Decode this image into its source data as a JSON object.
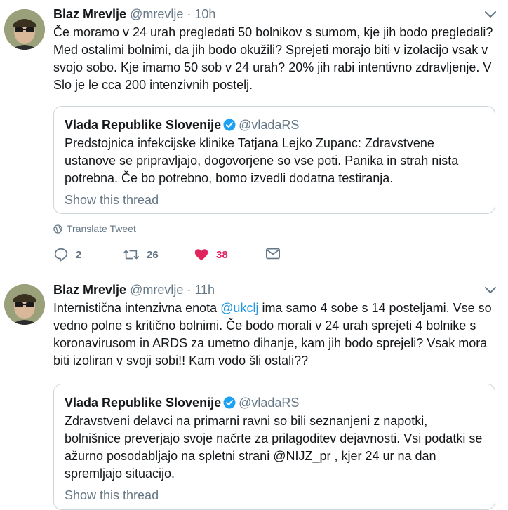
{
  "tweets": [
    {
      "author_name": "Blaz Mrevlje",
      "author_handle": "@mrevlje",
      "separator": "·",
      "time": "10h",
      "text": "Če moramo v 24 urah pregledati 50 bolnikov s sumom, kje jih bodo pregledali? Med ostalimi bolnimi, da jih bodo okužili? Sprejeti morajo biti v izolacijo vsak v svojo sobo. Kje imamo 50 sob v 24 urah? 20% jih rabi intentivno zdravljenje. V Slo je le cca 200 intenzivnih postelj.",
      "quote": {
        "name": "Vlada Republike Slovenije",
        "handle": "@vladaRS",
        "text": "Predstojnica infekcijske klinike Tatjana Lejko Zupanc: Zdravstvene ustanove se pripravljajo, dogovorjene so vse poti. Panika in strah nista potrebna. Če bo potrebno, bomo izvedli dodatna testiranja.",
        "show_thread": "Show this thread"
      },
      "translate_label": "Translate Tweet",
      "replies": "2",
      "retweets": "26",
      "likes": "38"
    },
    {
      "author_name": "Blaz Mrevlje",
      "author_handle": "@mrevlje",
      "separator": "·",
      "time": "11h",
      "text_before": "Internistična intenzivna enota ",
      "mention": "@ukclj",
      "text_after": " ima samo 4 sobe s 14 posteljami. Vse so vedno polne s kritično bolnimi. Če bodo morali v 24 urah sprejeti 4 bolnike s koronavirusom in ARDS za umetno dihanje, kam jih bodo sprejeli? Vsak mora biti izoliran v svoji sobi!! Kam vodo šli ostali??",
      "quote": {
        "name": "Vlada Republike Slovenije",
        "handle": "@vladaRS",
        "text": "Zdravstveni delavci na primarni ravni so bili seznanjeni z napotki, bolnišnice preverjajo svoje načrte za prilagoditev dejavnosti. Vsi podatki se ažurno posodabljajo na spletni strani @NIJZ_pr , kjer 24 ur na dan spremljajo situacijo.",
        "show_thread": "Show this thread"
      }
    }
  ],
  "colors": {
    "link": "#1b95e0",
    "muted": "#657786",
    "like": "#e0245e",
    "verified": "#1da1f2",
    "border": "#ccd6dd"
  },
  "icons": [
    "chevron-down-icon",
    "verified-badge-icon",
    "globe-icon",
    "reply-icon",
    "retweet-icon",
    "heart-icon",
    "message-icon"
  ]
}
